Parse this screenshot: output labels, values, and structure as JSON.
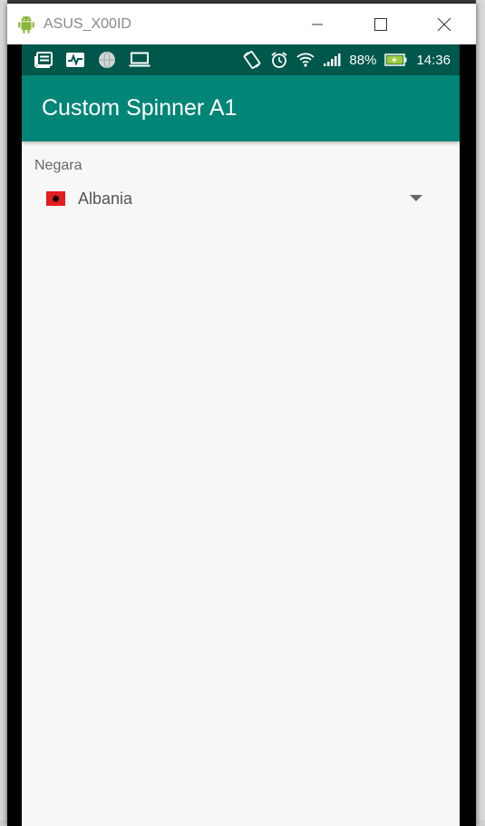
{
  "window": {
    "title": "ASUS_X00ID",
    "icon": "android-icon",
    "controls": [
      "minimize-icon",
      "maximize-icon",
      "close-icon"
    ]
  },
  "statusbar": {
    "left_icons": [
      "news-icon",
      "activity-icon",
      "globe-icon",
      "laptop-icon"
    ],
    "battery_percent": "88%",
    "time": "14:36",
    "colors": {
      "background": "#00574b"
    }
  },
  "appbar": {
    "title": "Custom Spinner A1",
    "color": "#008577"
  },
  "form": {
    "label": "Negara",
    "spinner": {
      "selected_value": "Albania",
      "flag_icon": "albania-flag-icon"
    }
  }
}
